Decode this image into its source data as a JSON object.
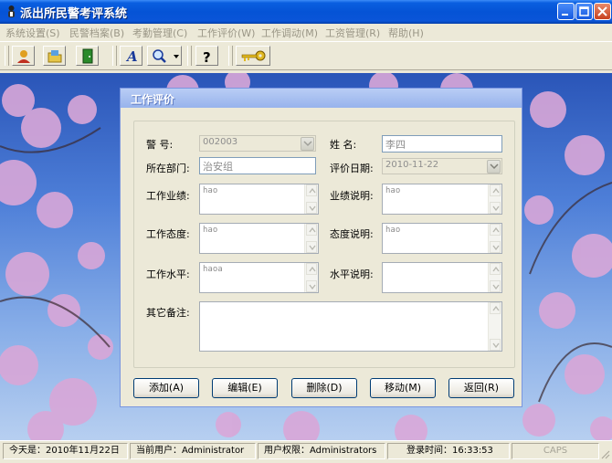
{
  "window": {
    "title": "派出所民警考评系统"
  },
  "menu": [
    "系统设置(S)",
    "民警档案(B)",
    "考勤管理(C)",
    "工作评价(W)",
    "工作调动(M)",
    "工资管理(R)",
    "帮助(H)"
  ],
  "dialog": {
    "title": "工作评价",
    "labels": {
      "police_no": "警    号:",
      "name": "姓    名:",
      "department": "所在部门:",
      "eval_date": "评价日期:",
      "performance": "工作业绩:",
      "performance_note": "业绩说明:",
      "attitude": "工作态度:",
      "attitude_note": "态度说明:",
      "level": "工作水平:",
      "level_note": "水平说明:",
      "remarks": "其它备注:"
    },
    "values": {
      "police_no": "002003",
      "name": "李四",
      "department": "治安组",
      "eval_date": "2010-11-22",
      "performance": "hao",
      "performance_note": "hao",
      "attitude": "hao",
      "attitude_note": "hao",
      "level": "haoa",
      "level_note": "",
      "remarks": ""
    },
    "buttons": {
      "add": "添加(A)",
      "edit": "编辑(E)",
      "delete": "删除(D)",
      "move": "移动(M)",
      "back": "返回(R)"
    }
  },
  "status": {
    "today": "今天是：2010年11月22日",
    "user": "当前用户：Administrator",
    "permission": "用户权限：Administrators",
    "login_time": "登录时间：16:33:53",
    "caps": "CAPS"
  },
  "colors": {
    "titlebar": "#0553d6",
    "close_button": "#c8421f",
    "dialog_caption": "#97b3ec"
  }
}
